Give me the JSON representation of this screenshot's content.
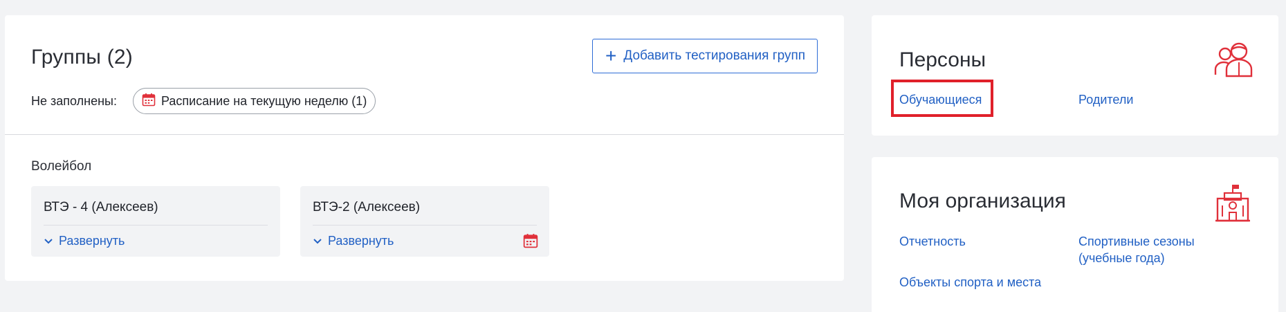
{
  "groups": {
    "title": "Группы (2)",
    "add_button_label": "Добавить тестирования групп",
    "unfilled_label": "Не заполнены:",
    "chip_label": "Расписание на текущую неделю (1)",
    "sport_name": "Волейбол",
    "tiles": [
      {
        "title": "ВТЭ - 4 (Алексеев)",
        "expand_label": "Развернуть",
        "has_calendar_icon": false
      },
      {
        "title": "ВТЭ-2 (Алексеев)",
        "expand_label": "Развернуть",
        "has_calendar_icon": true
      }
    ]
  },
  "persons": {
    "title": "Персоны",
    "icon": "people-icon",
    "links": [
      "Обучающиеся",
      "Родители"
    ],
    "highlighted_link": "Обучающиеся"
  },
  "organization": {
    "title": "Моя организация",
    "icon": "school-building-icon",
    "links": [
      "Отчетность",
      "Спортивные сезоны (учебные года)",
      "Объекты спорта и места"
    ]
  },
  "colors": {
    "background": "#f2f3f5",
    "link_blue": "#2160c4",
    "icon_red": "#e0303a",
    "highlight_red": "#e0202a"
  }
}
